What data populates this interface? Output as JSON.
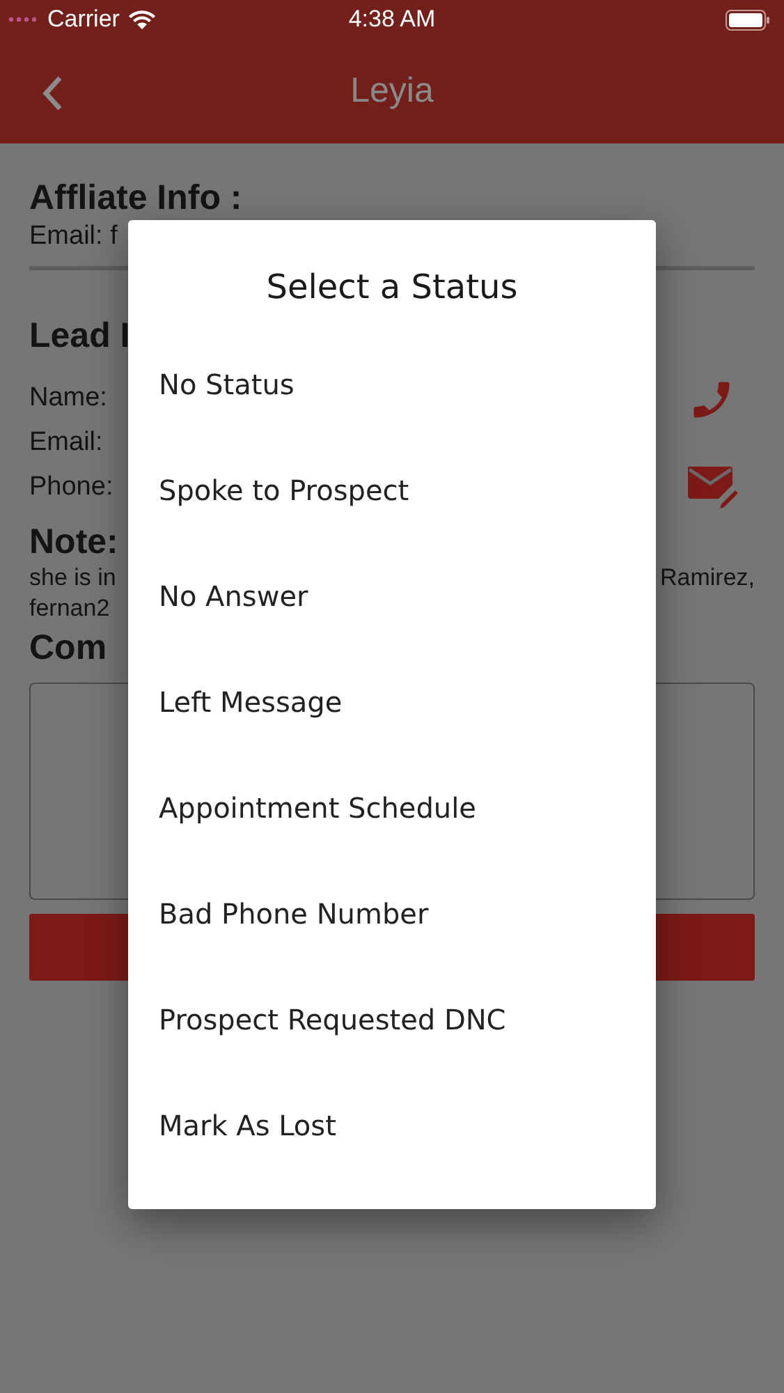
{
  "status_bar": {
    "carrier": "Carrier",
    "time": "4:38 AM"
  },
  "nav": {
    "title": "Leyia"
  },
  "affiliate": {
    "heading": "Affliate Info :",
    "email": "Email: f"
  },
  "lead": {
    "heading": "Lead I",
    "fields": [
      "Name:",
      "Email:",
      "Phone:"
    ]
  },
  "note": {
    "heading": "Note:",
    "text_left": "she is in",
    "text_right": "Ramirez,",
    "text_line2": "fernan2"
  },
  "comments": {
    "heading": "Com"
  },
  "dialog": {
    "title": "Select a Status",
    "options": [
      {
        "label": "No Status"
      },
      {
        "label": "Spoke to Prospect"
      },
      {
        "label": "No Answer"
      },
      {
        "label": "Left Message"
      },
      {
        "label": "Appointment Schedule"
      },
      {
        "label": "Bad Phone Number"
      },
      {
        "label": "Prospect Requested DNC"
      },
      {
        "label": "Mark As Lost"
      }
    ]
  }
}
